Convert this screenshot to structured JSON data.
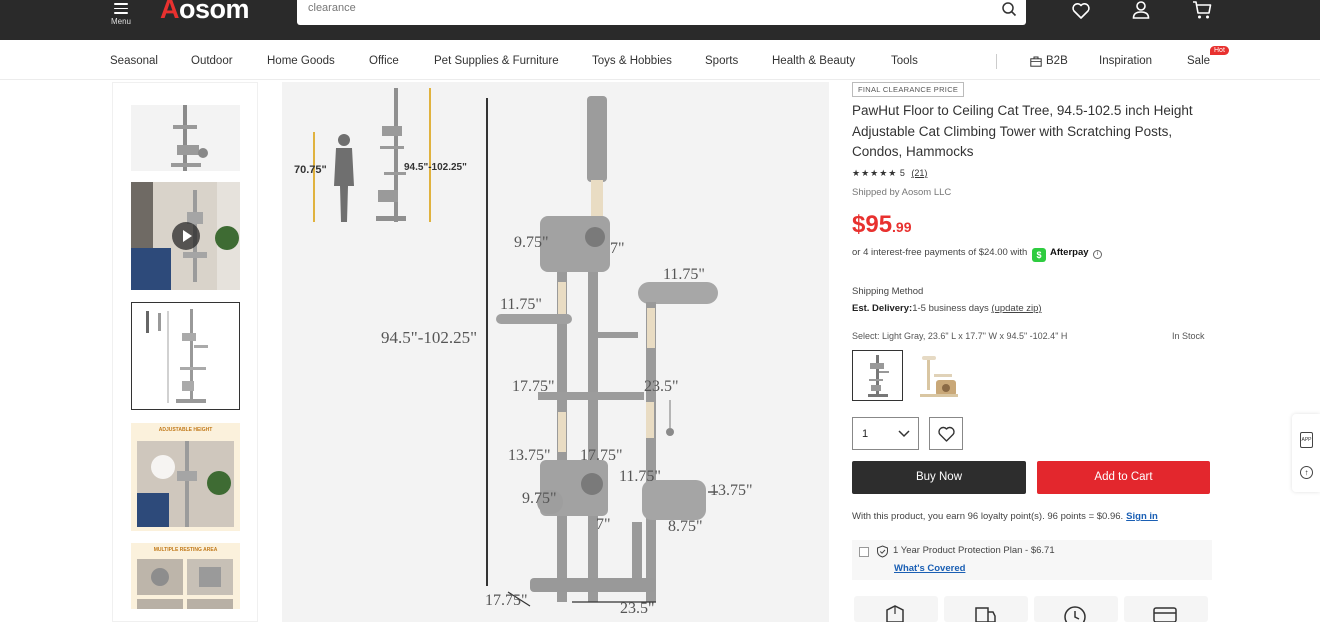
{
  "header": {
    "menu_label": "Menu",
    "logo": "Aosom",
    "search": {
      "value": "clearance",
      "placeholder": ""
    }
  },
  "nav": {
    "items": [
      "Seasonal",
      "Outdoor",
      "Home Goods",
      "Office",
      "Pet Supplies & Furniture",
      "Toys & Hobbies",
      "Sports",
      "Health & Beauty",
      "Tools",
      "B2B",
      "Inspiration",
      "Sale"
    ],
    "sale_badge": "Hot"
  },
  "gallery": {
    "thumb_captions": [
      "ADJUSTABLE HEIGHT",
      "MULTIPLE RESTING AREA"
    ],
    "main_dimensions": {
      "person_height": "70.75\"",
      "tree_range_small": "94.5\"-102.25\"",
      "tree_range": "94.5\"-102.25\"",
      "d1": "9.75\"",
      "d2": "7\"",
      "d3": "11.75\"",
      "d4": "11.75\"",
      "d5": "17.75\"",
      "d6": "23.5\"",
      "d7": "13.75\"",
      "d8": "17.75\"",
      "d9": "11.75\"",
      "d10": "9.75\"",
      "d11": "13.75\"",
      "d12": "7\"",
      "d13": "8.75\"",
      "d14": "17.75\"",
      "d15": "23.5\""
    }
  },
  "product": {
    "badge": "FINAL CLEARANCE PRICE",
    "title": "PawHut Floor to Ceiling Cat Tree, 94.5-102.5 inch Height Adjustable Cat Climbing Tower with Scratching Posts, Condos, Hammocks",
    "stars": "★★★★★",
    "rating": "5",
    "review_count": "(21)",
    "shipped_by": "Shipped by Aosom LLC",
    "price_dollars": "$95",
    "price_cents": ".99",
    "afterpay_text": "or 4 interest-free payments of $24.00 with",
    "afterpay_brand": "Afterpay",
    "shipping_method_label": "Shipping Method",
    "est_delivery_label": "Est. Delivery:",
    "est_delivery_value": "1-5 business days",
    "update_zip": "(update zip)",
    "select_text": "Select: Light Gray, 23.6\" L x 17.7\" W x 94.5\" -102.4\" H",
    "stock": "In Stock",
    "quantity": "1",
    "buy_now": "Buy Now",
    "add_to_cart": "Add to Cart",
    "loyalty_text": "With this product, you earn 96 loyalty point(s). 96 points = $0.96.",
    "sign_in": "Sign in",
    "protection_plan": "1 Year Product Protection Plan - $6.71",
    "whats_covered": "What's Covered"
  },
  "side_tools": {
    "app_label": "APP",
    "top_label": "↑"
  },
  "colors": {
    "brand_red": "#e8312f",
    "topbar": "#2a2a2a",
    "link_blue": "#1a5fb4",
    "afterpay_green": "#2ecc40"
  }
}
